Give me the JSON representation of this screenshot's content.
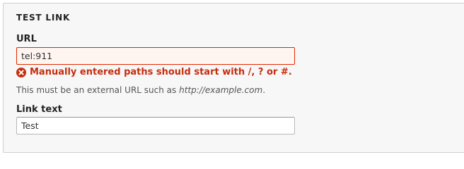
{
  "fieldset": {
    "legend": "TEST LINK"
  },
  "url_field": {
    "label": "URL",
    "value": "tel:911",
    "error": "Manually entered paths should start with /, ? or #.",
    "description_prefix": "This must be an external URL such as ",
    "description_example": "http://example.com",
    "description_suffix": "."
  },
  "link_text_field": {
    "label": "Link text",
    "value": "Test"
  },
  "colors": {
    "error": "#c62d0e",
    "error_border": "#e62600",
    "error_background": "#fef5f1"
  },
  "icons": {
    "error": "error-x-circle-icon"
  }
}
